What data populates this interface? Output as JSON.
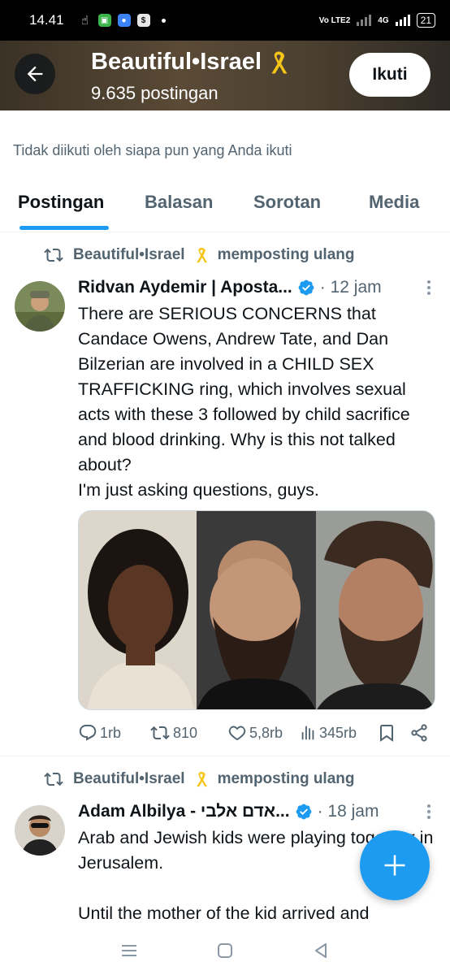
{
  "status_bar": {
    "time": "14.41",
    "volte": "Vo LTE2",
    "network": "4G",
    "battery": "21"
  },
  "header": {
    "title": "Beautiful•Israel",
    "subtitle": "9.635 postingan",
    "follow_label": "Ikuti"
  },
  "profile": {
    "not_followed_text": "Tidak diikuti oleh siapa pun yang Anda ikuti"
  },
  "tabs": [
    {
      "label": "Postingan",
      "active": true
    },
    {
      "label": "Balasan",
      "active": false
    },
    {
      "label": "Sorotan",
      "active": false
    },
    {
      "label": "Media",
      "active": false
    }
  ],
  "posts": [
    {
      "repost_by": "Beautiful•Israel",
      "repost_suffix": "memposting ulang",
      "author": "Ridvan Aydemir | Aposta...",
      "time": "· 12 jam",
      "text": "There are SERIOUS CONCERNS that Candace Owens, Andrew Tate, and Dan Bilzerian are involved in a CHILD SEX TRAFFICKING ring, which involves sexual acts with these 3 followed by child sacrifice and blood drinking. Why is this not talked about?\nI'm just asking questions, guys.",
      "replies": "1rb",
      "reposts": "810",
      "likes": "5,8rb",
      "views": "345rb"
    },
    {
      "repost_by": "Beautiful•Israel",
      "repost_suffix": "memposting ulang",
      "author": "Adam Albilya - אדם אלבי...",
      "time": "· 18 jam",
      "text": "Arab and Jewish kids were playing together in Jerusalem.\n\nUntil the mother of the kid arrived and"
    }
  ],
  "colors": {
    "accent": "#1d9bf0",
    "text": "#0f1419",
    "muted": "#536471",
    "ribbon": "#f5c518"
  }
}
